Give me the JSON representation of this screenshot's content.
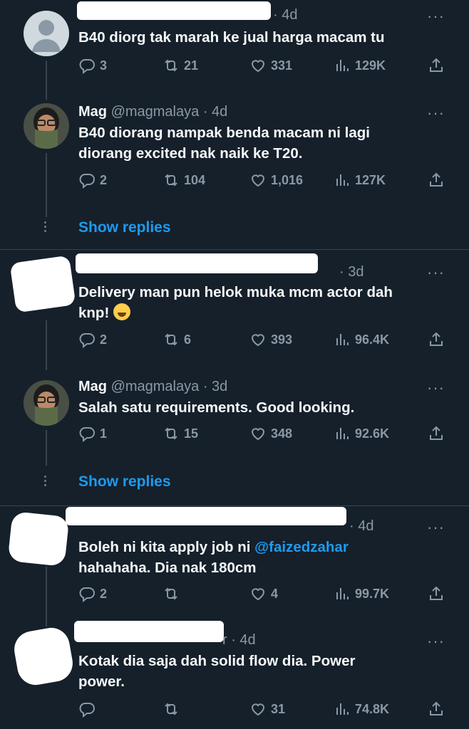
{
  "tweets": [
    {
      "name": "",
      "handle": "",
      "time": "· 4d",
      "text": "B40 diorg tak marah ke jual harga macam tu",
      "replies": "3",
      "retweets": "21",
      "likes": "331",
      "views": "129K"
    },
    {
      "name": "Mag",
      "handle": "@magmalaya",
      "time": "· 4d",
      "text_line1": "B40 diorang nampak benda macam ni lagi",
      "text_line2": "diorang excited nak naik ke T20.",
      "replies": "2",
      "retweets": "104",
      "likes": "1,016",
      "views": "127K"
    },
    {
      "name": "",
      "handle": "",
      "time": "· 3d",
      "text_line1": "Delivery man pun helok muka mcm actor dah",
      "text_line2": "knp!",
      "emoji": "grinning-sweat-emoji",
      "replies": "2",
      "retweets": "6",
      "likes": "393",
      "views": "96.4K"
    },
    {
      "name": "Mag",
      "handle": "@magmalaya",
      "time": "· 3d",
      "text": "Salah satu requirements. Good looking.",
      "replies": "1",
      "retweets": "15",
      "likes": "348",
      "views": "92.6K"
    },
    {
      "name": "",
      "handle": "",
      "time": "· 4d",
      "text_line1_prefix": "Boleh ni kita apply job ni ",
      "mention": "@faizedzahar",
      "text_line2": "hahahaha. Dia nak 180cm",
      "replies": "2",
      "retweets": "",
      "likes": "4",
      "views": "99.7K"
    },
    {
      "name": "",
      "handle": "",
      "time": "r · 4d",
      "text_line1": "Kotak dia saja dah solid flow dia. Power",
      "text_line2": "power.",
      "replies": "",
      "retweets": "",
      "likes": "31",
      "views": "74.8K"
    }
  ],
  "show_replies_label": "Show replies",
  "more_glyph": "···",
  "colors": {
    "background": "#15202b",
    "accent": "#1d9bf0",
    "muted": "#8b98a5"
  }
}
